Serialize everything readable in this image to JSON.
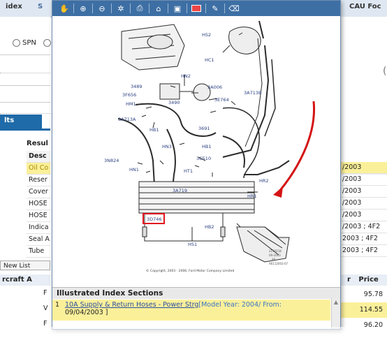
{
  "background": {
    "tabs": [
      "idex",
      "S"
    ],
    "right_tab": "CAU Foc",
    "radio_label": "SPN",
    "results_tab": "lts",
    "results_header": "Resul",
    "desc_header": "Desc",
    "rows": [
      "Oil Co",
      "Reser",
      "Cover",
      "HOSE",
      "HOSE",
      "Indica",
      "Seal A",
      "Tube"
    ],
    "right_rows": [
      "/2003",
      "/2003",
      "/2003",
      "/2003",
      "/2003",
      "/2003 ; 4F2",
      "2003 ; 4F2",
      "2003 ; 4F2"
    ],
    "view_list": "New List",
    "craft_header": "rcraft  A",
    "price_header": "Price",
    "prices": [
      "95.78",
      "114.55",
      "96.20"
    ],
    "price_marker": "r"
  },
  "viewer": {
    "toolbar_icons": [
      "hand-icon",
      "zoom-in-icon",
      "zoom-out-icon",
      "fit-icon",
      "print-icon",
      "home-icon",
      "image-icon",
      "rectangle-icon",
      "pen-icon",
      "eraser-icon"
    ],
    "labels": {
      "hs2": "HS2",
      "hc1": "HC1",
      "hn2": "HN2",
      "l3489": "3489",
      "l3a006": "3A006",
      "l3f656": "3F656",
      "hm1": "HM1",
      "l3e764": "3E764",
      "l3490": "3490",
      "l3a713b": "3A713B",
      "l3a713a": "3A713A",
      "hb1a": "HB1",
      "l3691": "3691",
      "hn3": "HN3",
      "hb1b": "HB1",
      "l3n824": "3N824",
      "l3c510": "3C510",
      "hn1": "HN1",
      "ht1": "HT1",
      "hr2": "HR2",
      "l3a719": "3A719",
      "hr1": "HR1",
      "l3d746": "3D746",
      "hb2": "HB2",
      "hs1": "HS1"
    },
    "copyright": "© Copyright, 2003 - 2006, Ford Motor Company Limited",
    "stamp": [
      "2110218",
      "09-2003",
      "A0",
      "A6112003-07"
    ],
    "highlight_color": "#e0141e",
    "arrow_color": "#d41414"
  },
  "sections": {
    "title": "Illustrated Index Sections",
    "items": [
      {
        "num": "1",
        "link": "10A Supply & Return Hoses - Power Strg",
        "meta": "[Model Year: 2004/ From:",
        "date": "09/04/2003 ]"
      }
    ]
  }
}
